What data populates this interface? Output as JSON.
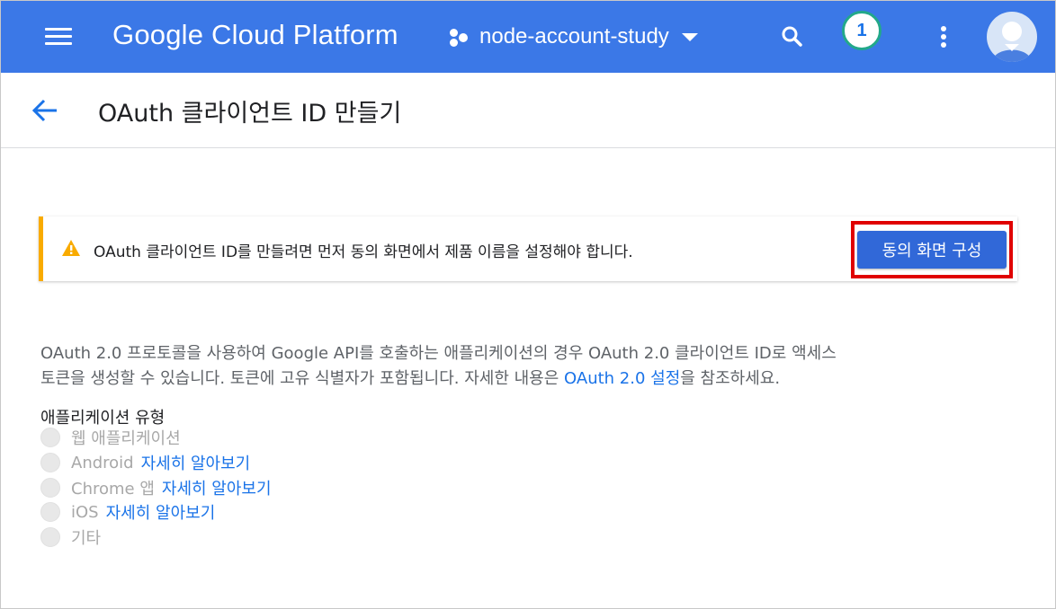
{
  "topbar": {
    "brand": "Google Cloud Platform",
    "project_name": "node-account-study",
    "notification_count": "1",
    "colors": {
      "bar": "#3b78e7",
      "badge_ring": "#22a88a"
    }
  },
  "header": {
    "title": "OAuth 클라이언트 ID 만들기"
  },
  "banner": {
    "message": "OAuth 클라이언트 ID를 만들려면 먼저 동의 화면에서 제품 이름을 설정해야 합니다.",
    "button_label": "동의 화면 구성",
    "icon": "warning-icon"
  },
  "description": {
    "line1": "OAuth 2.0 프로토콜을 사용하여 Google API를 호출하는 애플리케이션의 경우 OAuth 2.0 클라이언트 ID로 액세스",
    "line2_prefix": "토큰을 생성할 수 있습니다. 토큰에 고유 식별자가 포함됩니다. 자세한 내용은 ",
    "line2_link": "OAuth 2.0 설정",
    "line2_suffix": "을 참조하세요."
  },
  "app_type": {
    "label": "애플리케이션 유형",
    "options": [
      {
        "label": "웹 애플리케이션",
        "link": ""
      },
      {
        "label": "Android",
        "link": "자세히 알아보기"
      },
      {
        "label": "Chrome 앱",
        "link": "자세히 알아보기"
      },
      {
        "label": "iOS",
        "link": "자세히 알아보기"
      },
      {
        "label": "기타",
        "link": ""
      }
    ]
  }
}
